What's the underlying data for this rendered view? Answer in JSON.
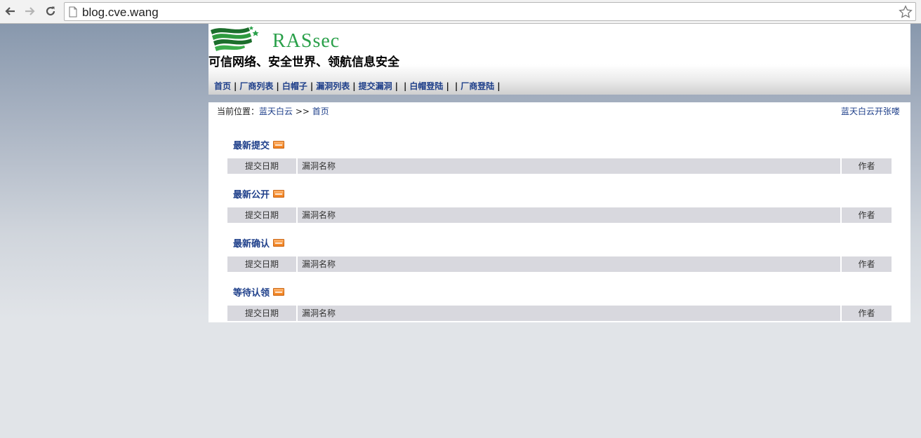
{
  "browser": {
    "url": "blog.cve.wang",
    "back_icon": "arrow-left-icon",
    "forward_icon": "arrow-right-icon",
    "reload_icon": "reload-icon",
    "page_icon": "page-icon",
    "bookmark_icon": "star-icon"
  },
  "header": {
    "brand": "RASsec",
    "slogan": "可信网络、安全世界、领航信息安全",
    "nav": [
      "首页",
      "厂商列表",
      "白帽子",
      "漏洞列表",
      "提交漏洞",
      "",
      "白帽登陆",
      "",
      "厂商登陆"
    ]
  },
  "breadcrumb": {
    "prefix": "当前位置：",
    "site": "蓝天白云",
    "sep": " >> ",
    "current": "首页"
  },
  "right_link": "蓝天白云开张喽",
  "sections": [
    {
      "title": "最新提交",
      "col_date": "提交日期",
      "col_name": "漏洞名称",
      "col_author": "作者"
    },
    {
      "title": "最新公开",
      "col_date": "提交日期",
      "col_name": "漏洞名称",
      "col_author": "作者"
    },
    {
      "title": "最新确认",
      "col_date": "提交日期",
      "col_name": "漏洞名称",
      "col_author": "作者"
    },
    {
      "title": "等待认领",
      "col_date": "提交日期",
      "col_name": "漏洞名称",
      "col_author": "作者"
    }
  ],
  "colors": {
    "brand_green": "#2aa04a",
    "link_blue": "#1e3f8a",
    "table_header": "#d8d8de"
  }
}
